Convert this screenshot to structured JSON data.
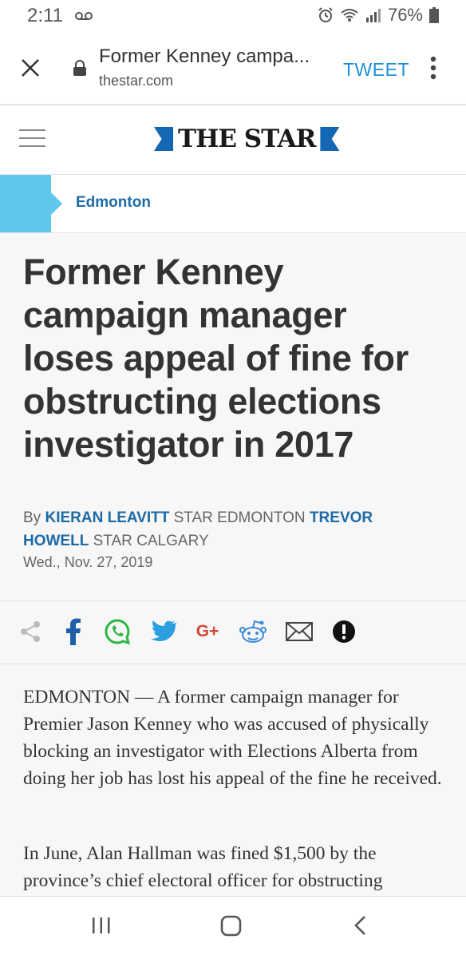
{
  "status_bar": {
    "time": "2:11",
    "battery": "76%"
  },
  "browser": {
    "page_title": "Former Kenney campa...",
    "domain": "thestar.com",
    "tweet_label": "TWEET"
  },
  "site": {
    "logo_text": "THE STAR",
    "section": "Edmonton",
    "brand_color": "#1467b3",
    "section_accent": "#5ec7ec"
  },
  "article": {
    "headline": "Former Kenney campaign manager loses appeal of fine for obstructing elections investigator in 2017",
    "byline": {
      "prefix": "By",
      "author1": "KIERAN LEAVITT",
      "affil1": "STAR EDMONTON",
      "author2": "TREVOR HOWELL",
      "affil2": "STAR CALGARY"
    },
    "date": "Wed., Nov. 27, 2019",
    "paragraphs": [
      "EDMONTON — A former campaign manager for Premier Jason Kenney who was accused of physically blocking an investigator with Elections Alberta from doing her job has lost his appeal of the fine he received.",
      "In June, Alan Hallman was fined $1,500 by the province’s chief electoral officer for obstructing"
    ]
  },
  "share_icons": [
    "share-icon",
    "facebook-icon",
    "whatsapp-icon",
    "twitter-icon",
    "google-plus-icon",
    "reddit-icon",
    "email-icon",
    "report-icon"
  ],
  "google_plus_label": "G+"
}
